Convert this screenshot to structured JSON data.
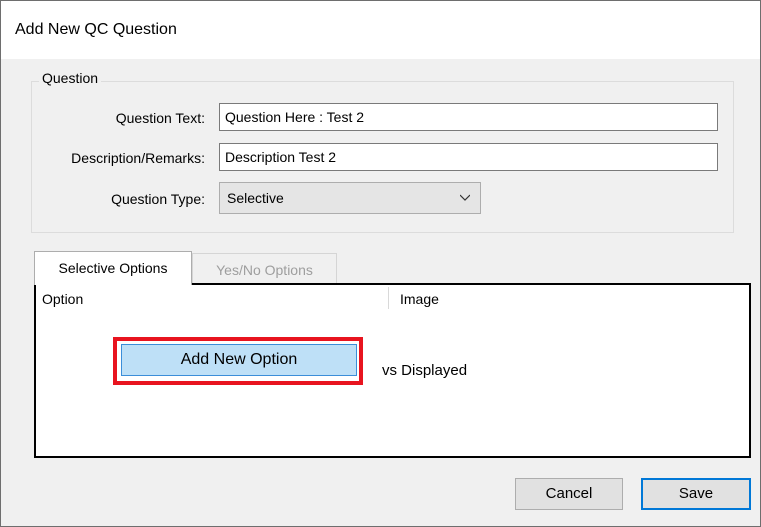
{
  "window": {
    "title": "Add New QC Question"
  },
  "question_group": {
    "legend": "Question",
    "question_text_label": "Question Text:",
    "question_text_value": "Question Here : Test 2",
    "description_label": "Description/Remarks:",
    "description_value": "Description Test 2",
    "question_type_label": "Question Type:",
    "question_type_value": "Selective"
  },
  "tabs": [
    {
      "label": "Selective Options",
      "active": true
    },
    {
      "label": "Yes/No Options",
      "active": false
    }
  ],
  "options_grid": {
    "columns": [
      "Option",
      "Image"
    ],
    "empty_message_visible": "vs Displayed"
  },
  "add_option_button": {
    "label": "Add New Option",
    "highlight_color": "#e8141f"
  },
  "footer": {
    "cancel_label": "Cancel",
    "save_label": "Save"
  },
  "colors": {
    "accent": "#0078d7",
    "button_hover": "#bee0f7"
  }
}
